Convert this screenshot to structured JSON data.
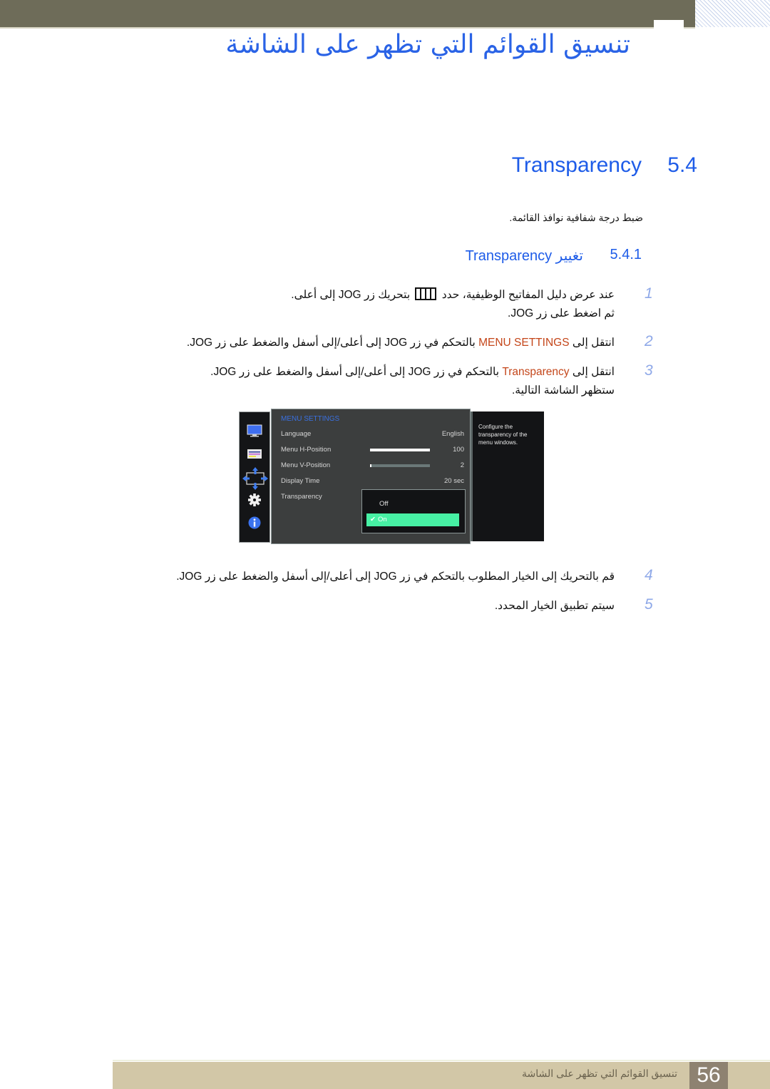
{
  "header": {
    "chapter_title": "تنسيق القوائم التي تظهر على الشاشة"
  },
  "section": {
    "number": "5.4",
    "title": "Transparency",
    "intro": "ضبط درجة شفافية نوافذ القائمة."
  },
  "subsection": {
    "number": "5.4.1",
    "title": "تغيير Transparency"
  },
  "steps": [
    {
      "num": "1",
      "text_a": "عند عرض دليل المفاتيح الوظيفية، حدد",
      "icon": "jog-menu-icon",
      "text_b": "بتحريك زر JOG إلى أعلى.",
      "line2": "ثم اضغط على زر JOG."
    },
    {
      "num": "2",
      "pre": "انتقل إلى",
      "highlight": "MENU SETTINGS",
      "post": "بالتحكم في زر JOG إلى أعلى/إلى أسفل والضغط على زر JOG."
    },
    {
      "num": "3",
      "pre": "انتقل إلى",
      "highlight": "Transparency",
      "post": "بالتحكم في زر JOG إلى أعلى/إلى أسفل والضغط على زر JOG.",
      "line2": "ستظهر الشاشة التالية."
    },
    {
      "num": "4",
      "text": "قم بالتحريك إلى الخيار المطلوب بالتحكم في زر JOG إلى أعلى/إلى أسفل والضغط على زر JOG."
    },
    {
      "num": "5",
      "text": "سيتم تطبيق الخيار المحدد."
    }
  ],
  "osd": {
    "side_icons": [
      "monitor-icon",
      "picture-settings-icon",
      "position-arrows-icon",
      "gear-icon",
      "info-icon"
    ],
    "header": "MENU SETTINGS",
    "rows": [
      {
        "label": "Language",
        "value": "English"
      },
      {
        "label": "Menu H-Position",
        "value": "100",
        "level": 100
      },
      {
        "label": "Menu V-Position",
        "value": "2",
        "level": 2
      },
      {
        "label": "Display Time",
        "value": "20 sec"
      },
      {
        "label": "Transparency",
        "value": ""
      }
    ],
    "dropdown": {
      "options": [
        "Off",
        "On"
      ],
      "selected": "On"
    },
    "help_text": "Configure the transparency of the menu windows."
  },
  "footer": {
    "page_number": "56",
    "chapter_title": "تنسيق القوائم التي تظهر على الشاشة"
  }
}
